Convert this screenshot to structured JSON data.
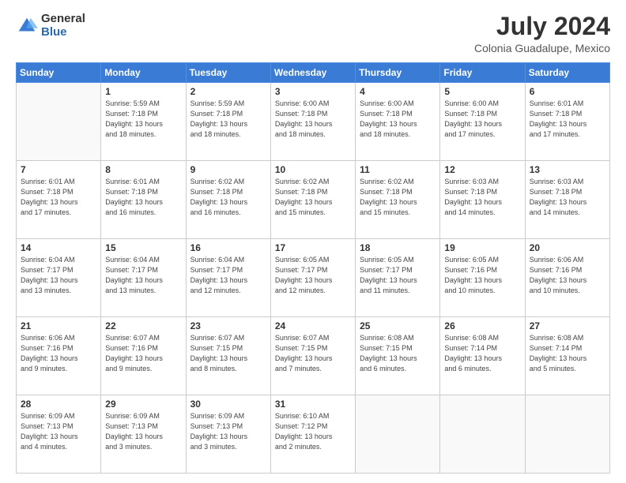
{
  "logo": {
    "general": "General",
    "blue": "Blue"
  },
  "header": {
    "month": "July 2024",
    "location": "Colonia Guadalupe, Mexico"
  },
  "days_of_week": [
    "Sunday",
    "Monday",
    "Tuesday",
    "Wednesday",
    "Thursday",
    "Friday",
    "Saturday"
  ],
  "weeks": [
    [
      {
        "day": "",
        "info": ""
      },
      {
        "day": "1",
        "info": "Sunrise: 5:59 AM\nSunset: 7:18 PM\nDaylight: 13 hours\nand 18 minutes."
      },
      {
        "day": "2",
        "info": "Sunrise: 5:59 AM\nSunset: 7:18 PM\nDaylight: 13 hours\nand 18 minutes."
      },
      {
        "day": "3",
        "info": "Sunrise: 6:00 AM\nSunset: 7:18 PM\nDaylight: 13 hours\nand 18 minutes."
      },
      {
        "day": "4",
        "info": "Sunrise: 6:00 AM\nSunset: 7:18 PM\nDaylight: 13 hours\nand 18 minutes."
      },
      {
        "day": "5",
        "info": "Sunrise: 6:00 AM\nSunset: 7:18 PM\nDaylight: 13 hours\nand 17 minutes."
      },
      {
        "day": "6",
        "info": "Sunrise: 6:01 AM\nSunset: 7:18 PM\nDaylight: 13 hours\nand 17 minutes."
      }
    ],
    [
      {
        "day": "7",
        "info": "Sunrise: 6:01 AM\nSunset: 7:18 PM\nDaylight: 13 hours\nand 17 minutes."
      },
      {
        "day": "8",
        "info": "Sunrise: 6:01 AM\nSunset: 7:18 PM\nDaylight: 13 hours\nand 16 minutes."
      },
      {
        "day": "9",
        "info": "Sunrise: 6:02 AM\nSunset: 7:18 PM\nDaylight: 13 hours\nand 16 minutes."
      },
      {
        "day": "10",
        "info": "Sunrise: 6:02 AM\nSunset: 7:18 PM\nDaylight: 13 hours\nand 15 minutes."
      },
      {
        "day": "11",
        "info": "Sunrise: 6:02 AM\nSunset: 7:18 PM\nDaylight: 13 hours\nand 15 minutes."
      },
      {
        "day": "12",
        "info": "Sunrise: 6:03 AM\nSunset: 7:18 PM\nDaylight: 13 hours\nand 14 minutes."
      },
      {
        "day": "13",
        "info": "Sunrise: 6:03 AM\nSunset: 7:18 PM\nDaylight: 13 hours\nand 14 minutes."
      }
    ],
    [
      {
        "day": "14",
        "info": "Sunrise: 6:04 AM\nSunset: 7:17 PM\nDaylight: 13 hours\nand 13 minutes."
      },
      {
        "day": "15",
        "info": "Sunrise: 6:04 AM\nSunset: 7:17 PM\nDaylight: 13 hours\nand 13 minutes."
      },
      {
        "day": "16",
        "info": "Sunrise: 6:04 AM\nSunset: 7:17 PM\nDaylight: 13 hours\nand 12 minutes."
      },
      {
        "day": "17",
        "info": "Sunrise: 6:05 AM\nSunset: 7:17 PM\nDaylight: 13 hours\nand 12 minutes."
      },
      {
        "day": "18",
        "info": "Sunrise: 6:05 AM\nSunset: 7:17 PM\nDaylight: 13 hours\nand 11 minutes."
      },
      {
        "day": "19",
        "info": "Sunrise: 6:05 AM\nSunset: 7:16 PM\nDaylight: 13 hours\nand 10 minutes."
      },
      {
        "day": "20",
        "info": "Sunrise: 6:06 AM\nSunset: 7:16 PM\nDaylight: 13 hours\nand 10 minutes."
      }
    ],
    [
      {
        "day": "21",
        "info": "Sunrise: 6:06 AM\nSunset: 7:16 PM\nDaylight: 13 hours\nand 9 minutes."
      },
      {
        "day": "22",
        "info": "Sunrise: 6:07 AM\nSunset: 7:16 PM\nDaylight: 13 hours\nand 9 minutes."
      },
      {
        "day": "23",
        "info": "Sunrise: 6:07 AM\nSunset: 7:15 PM\nDaylight: 13 hours\nand 8 minutes."
      },
      {
        "day": "24",
        "info": "Sunrise: 6:07 AM\nSunset: 7:15 PM\nDaylight: 13 hours\nand 7 minutes."
      },
      {
        "day": "25",
        "info": "Sunrise: 6:08 AM\nSunset: 7:15 PM\nDaylight: 13 hours\nand 6 minutes."
      },
      {
        "day": "26",
        "info": "Sunrise: 6:08 AM\nSunset: 7:14 PM\nDaylight: 13 hours\nand 6 minutes."
      },
      {
        "day": "27",
        "info": "Sunrise: 6:08 AM\nSunset: 7:14 PM\nDaylight: 13 hours\nand 5 minutes."
      }
    ],
    [
      {
        "day": "28",
        "info": "Sunrise: 6:09 AM\nSunset: 7:13 PM\nDaylight: 13 hours\nand 4 minutes."
      },
      {
        "day": "29",
        "info": "Sunrise: 6:09 AM\nSunset: 7:13 PM\nDaylight: 13 hours\nand 3 minutes."
      },
      {
        "day": "30",
        "info": "Sunrise: 6:09 AM\nSunset: 7:13 PM\nDaylight: 13 hours\nand 3 minutes."
      },
      {
        "day": "31",
        "info": "Sunrise: 6:10 AM\nSunset: 7:12 PM\nDaylight: 13 hours\nand 2 minutes."
      },
      {
        "day": "",
        "info": ""
      },
      {
        "day": "",
        "info": ""
      },
      {
        "day": "",
        "info": ""
      }
    ]
  ]
}
